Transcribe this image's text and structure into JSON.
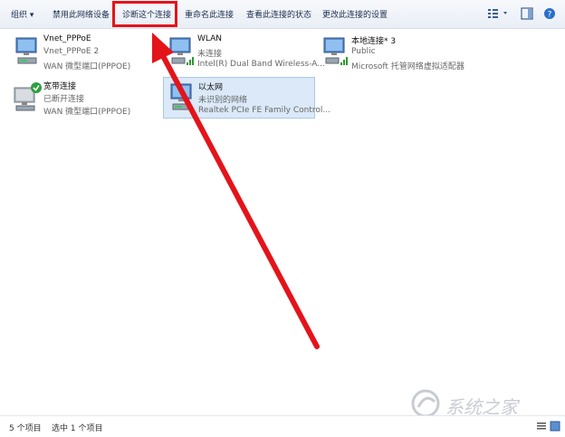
{
  "toolbar": {
    "organize": "组织",
    "disable": "禁用此网络设备",
    "diagnose": "诊断这个连接",
    "rename": "重命名此连接",
    "view_status": "查看此连接的状态",
    "change_settings": "更改此连接的设置"
  },
  "connections": [
    {
      "name": "Vnet_PPPoE",
      "line2": "Vnet_PPPoE  2",
      "line3": "WAN 微型端口(PPPOE)",
      "icon": "network-adapter-icon"
    },
    {
      "name": "WLAN",
      "line2": "未连接",
      "line3": "Intel(R) Dual Band Wireless-A...",
      "icon": "wireless-adapter-icon"
    },
    {
      "name": "本地连接* 3",
      "line2": "Public",
      "line3": "Microsoft 托管网络虚拟适配器",
      "icon": "wireless-adapter-icon"
    },
    {
      "name": "宽带连接",
      "line2": "已断开连接",
      "line3": "WAN 微型端口(PPPOE)",
      "icon": "broadband-icon"
    },
    {
      "name": "以太网",
      "line2": "未识别的网络",
      "line3": "Realtek PCIe FE Family Control...",
      "icon": "ethernet-adapter-icon"
    }
  ],
  "status": {
    "count": "5 个项目",
    "selected": "选中 1 个项目"
  },
  "watermark": "系统之家",
  "colors": {
    "highlight": "#e3141a",
    "arrow": "#e3141a",
    "selection": "#dbe9f8"
  }
}
